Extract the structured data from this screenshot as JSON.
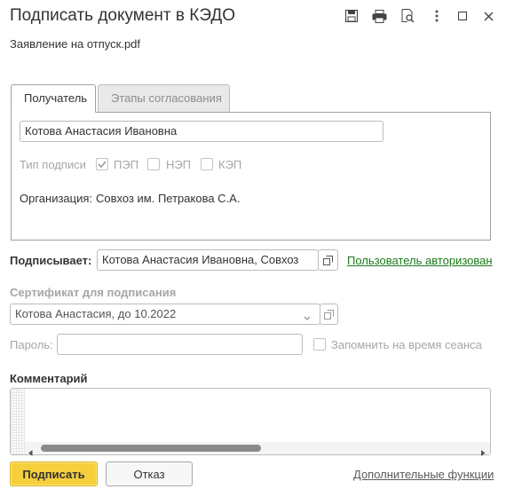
{
  "window": {
    "title": "Подписать документ в КЭДО",
    "document_name": "Заявление на отпуск.pdf"
  },
  "tabs": [
    {
      "label": "Получатель",
      "active": true
    },
    {
      "label": "Этапы согласования",
      "active": false
    }
  ],
  "recipient": {
    "name_value": "Котова Анастасия Ивановна",
    "signature_type_label": "Тип подписи",
    "signature_types": [
      {
        "label": "ПЭП",
        "checked": true
      },
      {
        "label": "НЭП",
        "checked": false
      },
      {
        "label": "КЭП",
        "checked": false
      }
    ],
    "organization_label": "Организация:",
    "organization_value": "Совхоз им. Петракова С.А."
  },
  "signer": {
    "label": "Подписывает:",
    "value": "Котова Анастасия Ивановна, Совхоз",
    "status_link": "Пользователь авторизован"
  },
  "certificate": {
    "label": "Сертификат для подписания",
    "value": "Котова Анастасия, до 10.2022"
  },
  "password": {
    "label": "Пароль:",
    "value": "",
    "remember_label": "Запомнить на время сеанса"
  },
  "comment": {
    "label": "Комментарий",
    "value": ""
  },
  "footer": {
    "sign_button": "Подписать",
    "cancel_button": "Отказ",
    "more_link": "Дополнительные функции"
  },
  "colors": {
    "primary_button": "#f6cf3c",
    "link_green": "#1a7a1a"
  }
}
